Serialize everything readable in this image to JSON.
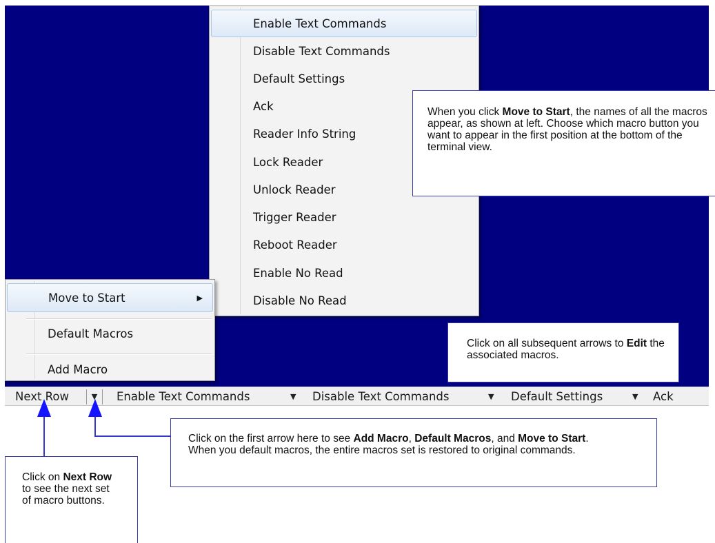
{
  "macro_list_menu": {
    "items": [
      "Enable Text Commands",
      "Disable Text Commands",
      "Default Settings",
      "Ack",
      "Reader Info String",
      "Lock Reader",
      "Unlock Reader",
      "Trigger Reader",
      "Reboot Reader",
      "Enable No Read",
      "Disable No Read"
    ]
  },
  "context_menu": {
    "move_to_start": "Move to Start",
    "default_macros": "Default Macros",
    "add_macro": "Add Macro"
  },
  "toolbar": {
    "next_row": "Next Row",
    "arrow_glyph": "▼",
    "macros": [
      "Enable Text Commands",
      "Disable Text Commands",
      "Default Settings",
      "Ack"
    ]
  },
  "callouts": {
    "move_to_start": {
      "pre": "When you click ",
      "bold": "Move to Start",
      "post": ", the names of all the macros appear, as shown at left. Choose which macro button you want to appear in the first position at the bottom of the terminal view."
    },
    "subsequent_arrows": {
      "pre": "Click on all subsequent arrows to ",
      "bold": "Edit",
      "post": " the associated macros."
    },
    "first_arrow": {
      "pre": "Click on the first arrow here to see ",
      "bold1": "Add Macro",
      "mid1": ", ",
      "bold2": "Default Macros",
      "mid2": ", and ",
      "bold3": "Move to Start",
      "post": ".",
      "line2": "When you default macros, the entire macros set is restored to original commands."
    },
    "next_row": {
      "pre": "Click on ",
      "bold": "Next Row",
      "post": " to see the next set of macro buttons."
    }
  },
  "colors": {
    "terminal_bg": "#000080",
    "callout_border": "#3a3aa8",
    "arrow": "#1414ff"
  }
}
